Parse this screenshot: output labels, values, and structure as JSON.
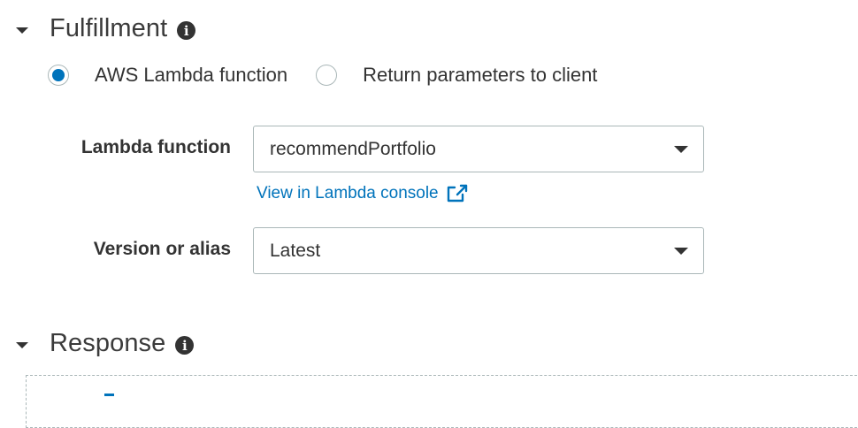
{
  "fulfillment": {
    "title": "Fulfillment",
    "options": {
      "lambda": "AWS Lambda function",
      "client": "Return parameters to client"
    },
    "selected": "lambda",
    "lambda_function": {
      "label": "Lambda function",
      "value": "recommendPortfolio"
    },
    "console_link": "View in Lambda console",
    "version": {
      "label": "Version or alias",
      "value": "Latest"
    }
  },
  "response": {
    "title": "Response"
  },
  "icons": {
    "info": "info-icon",
    "external_link": "external-link-icon",
    "collapse": "caret-down-icon"
  },
  "colors": {
    "accent": "#0073bb",
    "text": "#333333",
    "border": "#aab7b8"
  }
}
